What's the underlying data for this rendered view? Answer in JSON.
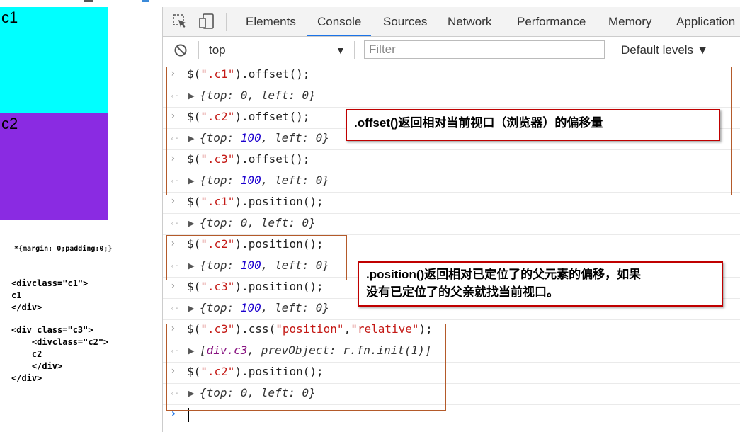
{
  "page": {
    "box_c1": "c1",
    "box_c2": "c2",
    "css_line": "*{margin: 0;padding:0;}",
    "code_block_1": "<divclass=\"c1\">\nc1\n</div>",
    "code_block_2": "<div class=\"c3\">\n    <divclass=\"c2\">\n    c2\n    </div>\n</div>",
    "colors": {
      "c1": "#00ffff",
      "c2": "#8a2be2"
    }
  },
  "devtools": {
    "tabs": [
      "Elements",
      "Console",
      "Sources",
      "Network",
      "Performance",
      "Memory",
      "Application"
    ],
    "active_tab": "Console",
    "toolbar_icons": [
      "inspect-icon",
      "device-toggle-icon"
    ]
  },
  "filterbar": {
    "context": "top",
    "filter_placeholder": "Filter",
    "levels": "Default levels",
    "caret": "▼"
  },
  "console": {
    "entries": [
      {
        "input": [
          [
            "$(",
            ""
          ],
          [
            "\".c1\"",
            "str"
          ],
          [
            ").offset();",
            ""
          ]
        ],
        "output": [
          [
            "{top: ",
            ""
          ],
          [
            "0",
            ""
          ],
          [
            ", left: ",
            ""
          ],
          [
            "0",
            ""
          ],
          [
            "}",
            ""
          ]
        ]
      },
      {
        "input": [
          [
            "$(",
            ""
          ],
          [
            "\".c2\"",
            "str"
          ],
          [
            ").offset();",
            ""
          ]
        ],
        "output": [
          [
            "{top: ",
            ""
          ],
          [
            "100",
            "num"
          ],
          [
            ", left: ",
            ""
          ],
          [
            "0",
            ""
          ],
          [
            "}",
            ""
          ]
        ]
      },
      {
        "input": [
          [
            "$(",
            ""
          ],
          [
            "\".c3\"",
            "str"
          ],
          [
            ").offset();",
            ""
          ]
        ],
        "output": [
          [
            "{top: ",
            ""
          ],
          [
            "100",
            "num"
          ],
          [
            ", left: ",
            ""
          ],
          [
            "0",
            ""
          ],
          [
            "}",
            ""
          ]
        ]
      },
      {
        "input": [
          [
            "$(",
            ""
          ],
          [
            "\".c1\"",
            "str"
          ],
          [
            ").position();",
            ""
          ]
        ],
        "output": [
          [
            "{top: ",
            ""
          ],
          [
            "0",
            ""
          ],
          [
            ", left: ",
            ""
          ],
          [
            "0",
            ""
          ],
          [
            "}",
            ""
          ]
        ]
      },
      {
        "input": [
          [
            "$(",
            ""
          ],
          [
            "\".c2\"",
            "str"
          ],
          [
            ").position();",
            ""
          ]
        ],
        "output": [
          [
            "{top: ",
            ""
          ],
          [
            "100",
            "num"
          ],
          [
            ", left: ",
            ""
          ],
          [
            "0",
            ""
          ],
          [
            "}",
            ""
          ]
        ]
      },
      {
        "input": [
          [
            "$(",
            ""
          ],
          [
            "\".c3\"",
            "str"
          ],
          [
            ").position();",
            ""
          ]
        ],
        "output": [
          [
            "{top: ",
            ""
          ],
          [
            "100",
            "num"
          ],
          [
            ", left: ",
            ""
          ],
          [
            "0",
            ""
          ],
          [
            "}",
            ""
          ]
        ]
      },
      {
        "input": [
          [
            "$(",
            ""
          ],
          [
            "\".c3\"",
            "str"
          ],
          [
            ").css(",
            ""
          ],
          [
            "\"position\"",
            "str"
          ],
          [
            ",",
            ""
          ],
          [
            "\"relative\"",
            "str"
          ],
          [
            ");",
            ""
          ]
        ],
        "output": [
          [
            "[",
            ""
          ],
          [
            "div.c3",
            "cls"
          ],
          [
            ", prevObject: r.fn.init(1)]",
            ""
          ]
        ]
      },
      {
        "input": [
          [
            "$(",
            ""
          ],
          [
            "\".c2\"",
            "str"
          ],
          [
            ").position();",
            ""
          ]
        ],
        "output": [
          [
            "{top: ",
            ""
          ],
          [
            "0",
            ""
          ],
          [
            ", left: ",
            ""
          ],
          [
            "0",
            ""
          ],
          [
            "}",
            ""
          ]
        ]
      }
    ],
    "input_prompt": "›",
    "output_prompt": "‹·",
    "expand_glyph": "▶"
  },
  "annotations": {
    "note1_bold": ".offset()",
    "note1_text": "返回相对当前视口（浏览器）的偏移量",
    "note2_bold": ".position()",
    "note2_text": "返回相对已定位了的父元素的偏移，如果",
    "note2_line2": "没有已定位了的父亲就找当前视口。"
  }
}
